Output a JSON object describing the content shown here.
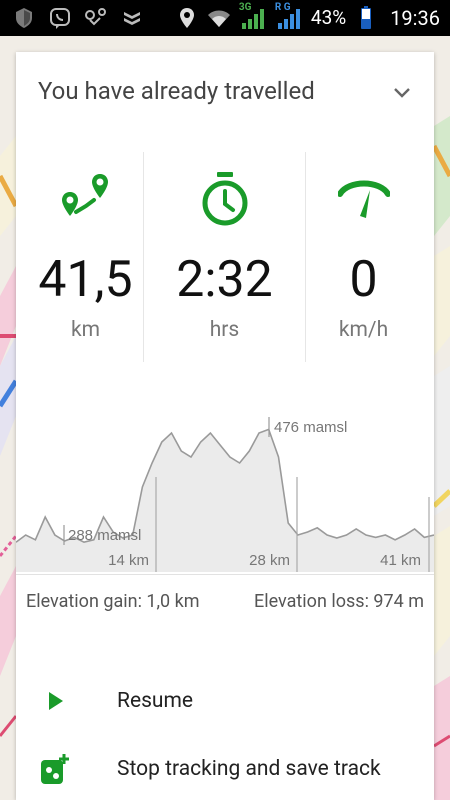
{
  "status_bar": {
    "battery_percent": "43%",
    "time": "19:36",
    "network_3g": "3G",
    "network_rg": "R G",
    "icons": [
      "shield-icon",
      "viber-icon",
      "route-icon",
      "drop-icon",
      "location-icon",
      "wifi-icon",
      "signal-icon",
      "signal-icon",
      "battery-icon"
    ]
  },
  "card": {
    "title": "You have already travelled",
    "stats": [
      {
        "icon": "distance-icon",
        "value": "41,5",
        "unit": "km"
      },
      {
        "icon": "stopwatch-icon",
        "value": "2:32",
        "unit": "hrs"
      },
      {
        "icon": "speedometer-icon",
        "value": "0",
        "unit": "km/h"
      }
    ],
    "chart_data": {
      "type": "area",
      "series": [
        {
          "values": [
            288,
            300,
            292,
            330,
            300,
            290,
            296,
            288,
            292,
            330,
            305,
            295,
            300,
            380,
            420,
            455,
            470,
            440,
            430,
            455,
            470,
            450,
            430,
            420,
            440,
            470,
            476,
            430,
            320,
            300,
            305,
            312,
            300,
            295,
            300,
            310,
            300,
            296,
            300,
            292,
            300,
            310,
            296,
            300
          ]
        }
      ],
      "annotations": [
        "476 mamsl",
        "288 mamsl"
      ],
      "x_tick_labels": [
        "14 km",
        "28 km",
        "41 km"
      ]
    },
    "elevation_gain": "Elevation gain: 1,0 km",
    "elevation_loss": "Elevation loss: 974 m",
    "actions": [
      {
        "icon": "play-icon",
        "label": "Resume"
      },
      {
        "icon": "stop-save-icon",
        "label": "Stop tracking and save track"
      }
    ],
    "accent_color": "#1a9b2a"
  }
}
